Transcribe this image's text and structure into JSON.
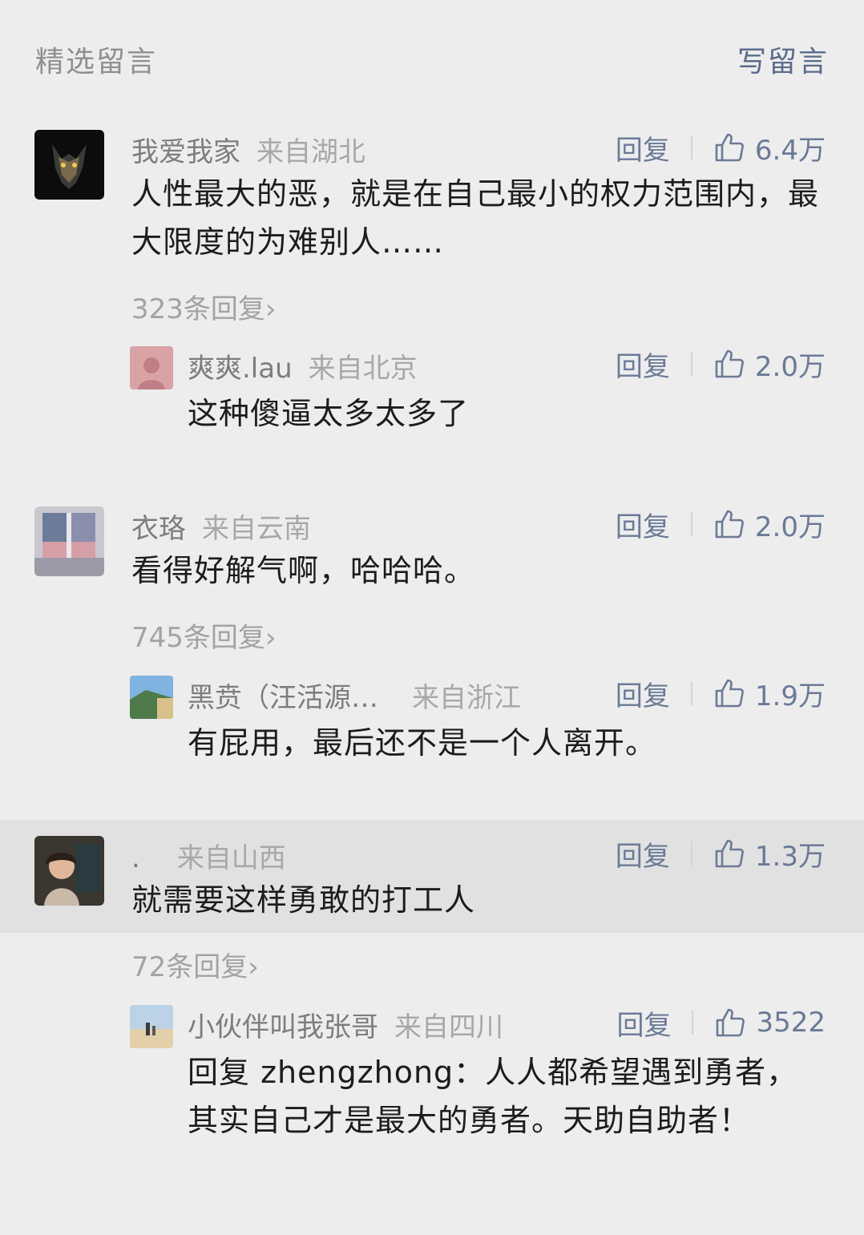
{
  "header": {
    "title": "精选留言",
    "write": "写留言"
  },
  "comments": [
    {
      "user": "我爱我家",
      "location": "来自湖北",
      "reply_label": "回复",
      "likes": "6.4万",
      "text": "人性最大的恶，就是在自己最小的权力范围内，最大限度的为难别人……",
      "more_replies": "323条回复",
      "sub": {
        "user": "爽爽.lau",
        "location": "来自北京",
        "reply_label": "回复",
        "likes": "2.0万",
        "text": "这种傻逼太多太多了"
      }
    },
    {
      "user": "衣珞",
      "location": "来自云南",
      "reply_label": "回复",
      "likes": "2.0万",
      "text": "看得好解气啊，哈哈哈。",
      "more_replies": "745条回复",
      "sub": {
        "user": "黑贲（汪活源…",
        "location": "来自浙江",
        "reply_label": "回复",
        "likes": "1.9万",
        "text": "有屁用，最后还不是一个人离开。"
      }
    },
    {
      "user": ".",
      "location": "来自山西",
      "reply_label": "回复",
      "likes": "1.3万",
      "text": "就需要这样勇敢的打工人",
      "more_replies": "72条回复",
      "sub": {
        "user": "小伙伴叫我张哥",
        "location": "来自四川",
        "reply_label": "回复",
        "likes": "3522",
        "text": "回复 zhengzhong：人人都希望遇到勇者，其实自己才是最大的勇者。天助自助者！"
      }
    }
  ],
  "icons": {
    "like": "thumbs-up-icon",
    "more_arrow": "chevron-right-icon"
  },
  "colors": {
    "link": "#6c7a97",
    "muted": "#a3a3a3",
    "background": "#ededed",
    "highlight": "#e1e1e1"
  }
}
